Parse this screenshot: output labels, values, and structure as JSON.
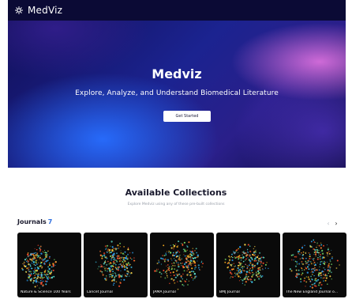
{
  "app": {
    "brand": "MedViz"
  },
  "hero": {
    "title": "Medviz",
    "subtitle": "Explore, Analyze, and Understand Biomedical Literature",
    "cta_label": "Get Started"
  },
  "collections": {
    "title": "Available Collections",
    "subtitle": "Explore Medviz using any of these pre-built collections"
  },
  "journals": {
    "label": "Journals",
    "count": "7",
    "prev_icon": "chevron-left-icon",
    "next_icon": "chevron-right-icon",
    "items": [
      {
        "label": "Nature & Science 100 Years"
      },
      {
        "label": "Lancet Journal"
      },
      {
        "label": "JAMA Journal"
      },
      {
        "label": "BMJ Journal"
      },
      {
        "label": "The New England Journal o..."
      }
    ]
  },
  "colors": {
    "navbar_bg": "#0b0a35",
    "accent_blue": "#2f6fe0",
    "card_bg": "#0a0a0a"
  }
}
